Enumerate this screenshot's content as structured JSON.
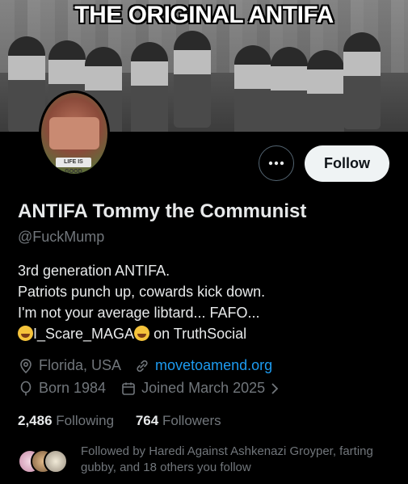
{
  "banner": {
    "title": "THE ORIGINAL ANTIFA"
  },
  "avatar": {
    "plate_text": "LIFE IS GOOD"
  },
  "actions": {
    "more_icon": "more-horizontal-icon",
    "follow_label": "Follow"
  },
  "profile": {
    "display_name": "ANTIFA Tommy the Communist",
    "handle": "@FuckMump",
    "bio": {
      "line1": "3rd generation ANTIFA.",
      "line2": "Patriots punch up, cowards kick down.",
      "line3": "I'm not your average libtard... FAFO...",
      "line4_mid": "I_Scare_MAGA",
      "line4_end": " on TruthSocial"
    },
    "location": "Florida, USA",
    "website": "movetoamend.org",
    "born": "Born 1984",
    "joined": "Joined March 2025"
  },
  "stats": {
    "following_count": "2,486",
    "following_label": "Following",
    "followers_count": "764",
    "followers_label": "Followers"
  },
  "followed_by": "Followed by Haredi Against Ashkenazi Groyper, farting gubby, and 18 others you follow",
  "colors": {
    "link": "#1d9bf0",
    "muted": "#71767b",
    "text": "#e7e9ea",
    "follow_bg": "#eff3f4"
  }
}
